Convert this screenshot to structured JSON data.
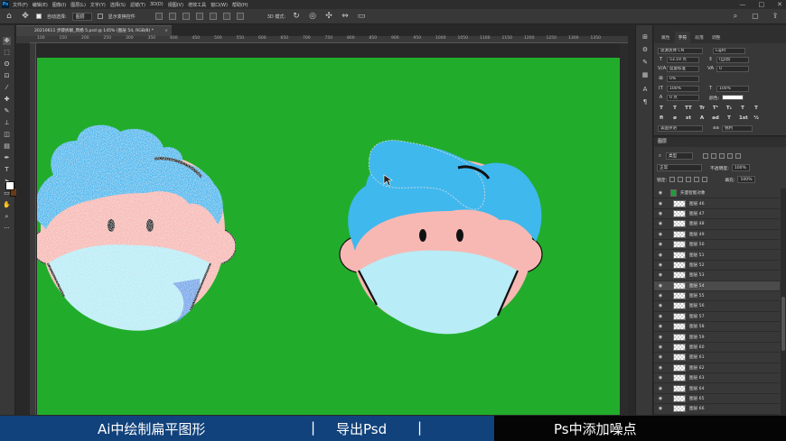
{
  "menubar": {
    "app_icon": "Ps",
    "items": [
      "文件(F)",
      "编辑(E)",
      "图像(I)",
      "图层(L)",
      "文字(Y)",
      "选择(S)",
      "滤镜(T)",
      "3D(D)",
      "视图(V)",
      "增效工具",
      "窗口(W)",
      "帮助(H)"
    ],
    "window_controls": [
      "—",
      "□",
      "✕"
    ]
  },
  "options_bar": {
    "auto_select_label": "自动选择:",
    "auto_select_value": "图层",
    "show_transform_label": "显示变换控件",
    "mode_3d_label": "3D 模式:"
  },
  "document": {
    "tab_title": "20210611 步骤拆解_周杨 5.psd @ 145% (图层 54, RGB/8) *",
    "tab_close": "×",
    "ruler_ticks": [
      "100",
      "150",
      "200",
      "250",
      "300",
      "350",
      "400",
      "450",
      "500",
      "550",
      "600",
      "650",
      "700",
      "750",
      "800",
      "850",
      "900",
      "950",
      "1000",
      "1050",
      "1100",
      "1150",
      "1200",
      "1250",
      "1300",
      "1350"
    ],
    "canvas_color": "#21ad2b"
  },
  "character_panel": {
    "tabs": [
      "属性",
      "字符",
      "段落",
      "调整"
    ],
    "active_tab": "字符",
    "font_family": "思源黑体 CN",
    "font_style": "Light",
    "font_size": "53.19 点",
    "leading": "(自动)",
    "kerning": "度量标准",
    "tracking": "0",
    "scale_percent": "0%",
    "vertical_scale": "100%",
    "horizontal_scale": "100%",
    "baseline_shift": "0 点",
    "color_label": "颜色:",
    "style_buttons": [
      "T",
      "T",
      "TT",
      "Tr",
      "T¹",
      "T₁",
      "T",
      "T"
    ],
    "opentype_buttons": [
      "fi",
      "ø",
      "st",
      "A",
      "ad",
      "T",
      "1st",
      "½"
    ],
    "language": "美国英语",
    "antialias_icon": "aa",
    "antialias": "锐利"
  },
  "layers_panel": {
    "title": "图层",
    "filter_kind": "类型",
    "blend_mode": "正常",
    "opacity_label": "不透明度:",
    "opacity": "100%",
    "lock_label": "锁定:",
    "fill_label": "填充:",
    "fill": "100%",
    "layers": [
      {
        "name": "矢量智能对象",
        "group": true
      },
      {
        "name": "图层 46"
      },
      {
        "name": "图层 47"
      },
      {
        "name": "图层 48"
      },
      {
        "name": "图层 49"
      },
      {
        "name": "图层 50"
      },
      {
        "name": "图层 51"
      },
      {
        "name": "图层 52"
      },
      {
        "name": "图层 53"
      },
      {
        "name": "图层 54",
        "selected": true
      },
      {
        "name": "图层 55"
      },
      {
        "name": "图层 56"
      },
      {
        "name": "图层 57"
      },
      {
        "name": "图层 58"
      },
      {
        "name": "图层 59"
      },
      {
        "name": "图层 60"
      },
      {
        "name": "图层 61"
      },
      {
        "name": "图层 62"
      },
      {
        "name": "图层 63"
      },
      {
        "name": "图层 64"
      },
      {
        "name": "图层 65"
      },
      {
        "name": "图层 66"
      }
    ]
  },
  "caption": {
    "step1": "Ai中绘制扁平图形",
    "sep1": "|",
    "step2": "导出Psd",
    "sep2": "|",
    "step3": "Ps中添加噪点"
  },
  "colors": {
    "foreground": "#ffffff",
    "background": "#6b3a17",
    "hair": "#3fb8ee",
    "skin": "#f7b8b3",
    "mask": "#b8ecf6"
  }
}
